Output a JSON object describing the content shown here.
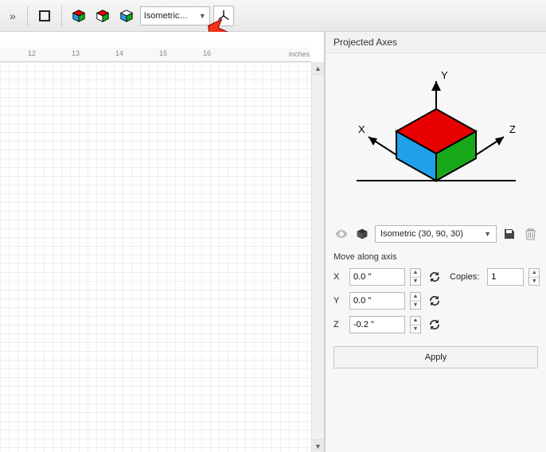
{
  "toolbar": {
    "preset_label": "Isometric…"
  },
  "ruler": {
    "ticks": [
      "12",
      "13",
      "14",
      "15",
      "16"
    ],
    "unit": "inches"
  },
  "panel": {
    "title": "Projected Axes",
    "axis_x": "X",
    "axis_y": "Y",
    "axis_z": "Z",
    "preset_value": "Isometric (30, 90, 30)",
    "move_label": "Move along axis",
    "x_label": "X",
    "y_label": "Y",
    "z_label": "Z",
    "x_value": "0.0 \"",
    "y_value": "0.0 \"",
    "z_value": "-0.2 \"",
    "copies_label": "Copies:",
    "copies_value": "1",
    "apply_label": "Apply"
  }
}
